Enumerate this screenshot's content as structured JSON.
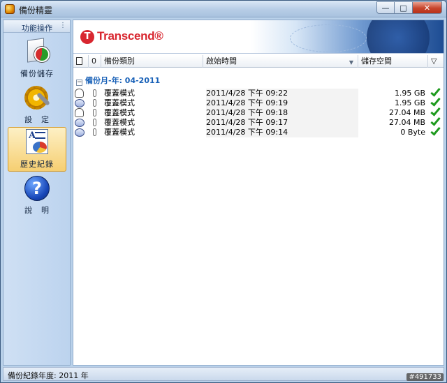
{
  "window": {
    "title": "備份精靈",
    "buttons": {
      "minimize": "—",
      "maximize": "□",
      "close": "✕"
    }
  },
  "sidebar": {
    "header": "功能操作",
    "grip": "⋮",
    "items": [
      {
        "label": "備份儲存",
        "icon": "backup-icon"
      },
      {
        "label": "設　定",
        "icon": "settings-icon"
      },
      {
        "label": "歷史紀錄",
        "icon": "history-icon",
        "active": true
      },
      {
        "label": "說　明",
        "icon": "help-icon",
        "glyph": "?"
      }
    ]
  },
  "banner": {
    "logo_mark": "T",
    "brand": "Transcend®"
  },
  "table": {
    "columns": {
      "type": "備份類別",
      "time": "啟始時間",
      "size": "儲存空間"
    },
    "sort_glyph": "▼",
    "filter_glyph": "▽",
    "clip_glyph": "0",
    "group": {
      "toggle": "−",
      "label": "備份月-年: 04-2011"
    },
    "rows": [
      {
        "icon": "hand-icon",
        "type": "覆蓋模式",
        "time": "2011/4/28 下午 09:22",
        "size": "1.95 GB"
      },
      {
        "icon": "disk-icon",
        "type": "覆蓋模式",
        "time": "2011/4/28 下午 09:19",
        "size": "1.95 GB"
      },
      {
        "icon": "hand-icon",
        "type": "覆蓋模式",
        "time": "2011/4/28 下午 09:18",
        "size": "27.04 MB"
      },
      {
        "icon": "disk-icon",
        "type": "覆蓋模式",
        "time": "2011/4/28 下午 09:17",
        "size": "27.04 MB"
      },
      {
        "icon": "disk-icon",
        "type": "覆蓋模式",
        "time": "2011/4/28 下午 09:14",
        "size": "0 Byte"
      }
    ]
  },
  "status": {
    "text": "備份紀錄年度: 2011 年"
  },
  "watermark": "#491733",
  "colors": {
    "accent": "#1a62b8",
    "brand": "#d8262f",
    "check": "#1e9a1e"
  }
}
